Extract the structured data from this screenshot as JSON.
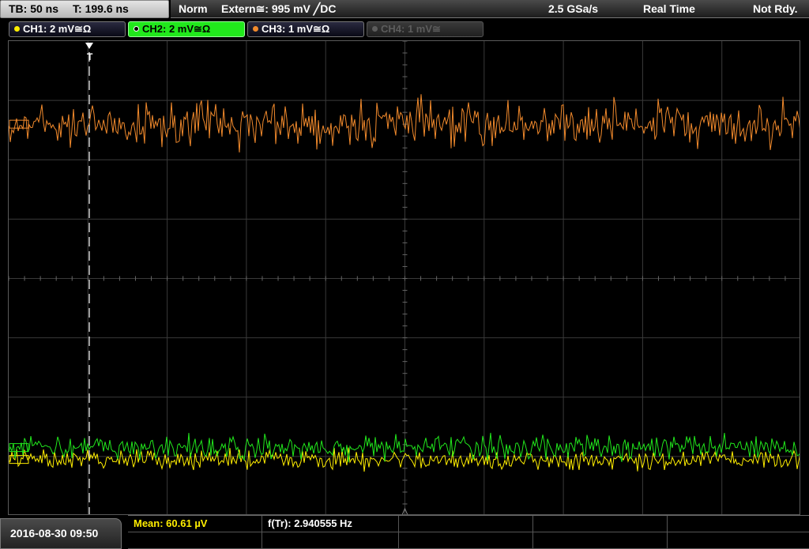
{
  "header": {
    "timebase": "TB: 50 ns",
    "trigger_time": "T: 199.6 ns",
    "mode": "Norm",
    "trigger_source": "Extern≅: 995 mV ╱DC",
    "sample_rate": "2.5 GSa/s",
    "acq_mode": "Real Time",
    "status": "Not Rdy."
  },
  "channels": [
    {
      "label": "CH1: 2 mV≅Ω",
      "color": "#ffee00",
      "state": "on"
    },
    {
      "label": "CH2: 2 mV≅Ω",
      "color": "#21e81c",
      "state": "selected"
    },
    {
      "label": "CH3: 1 mV≅Ω",
      "color": "#f28a2c",
      "state": "on"
    },
    {
      "label": "CH4: 1 mV≅",
      "color": "#5c5c5c",
      "state": "off"
    }
  ],
  "traces": {
    "ch3_level_div": 2.6,
    "ch2_level_div": -2.85,
    "ch1_level_div": -3.05
  },
  "footer": {
    "datetime": "2016-08-30 09:50",
    "measurement_1": "Mean: 60.61 µV",
    "measurement_2": "f(Tr): 2.940555 Hz"
  },
  "colors": {
    "ch1": "#ffee00",
    "ch2": "#21e81c",
    "ch3": "#f28a2c",
    "grid": "#3a3a3a"
  }
}
